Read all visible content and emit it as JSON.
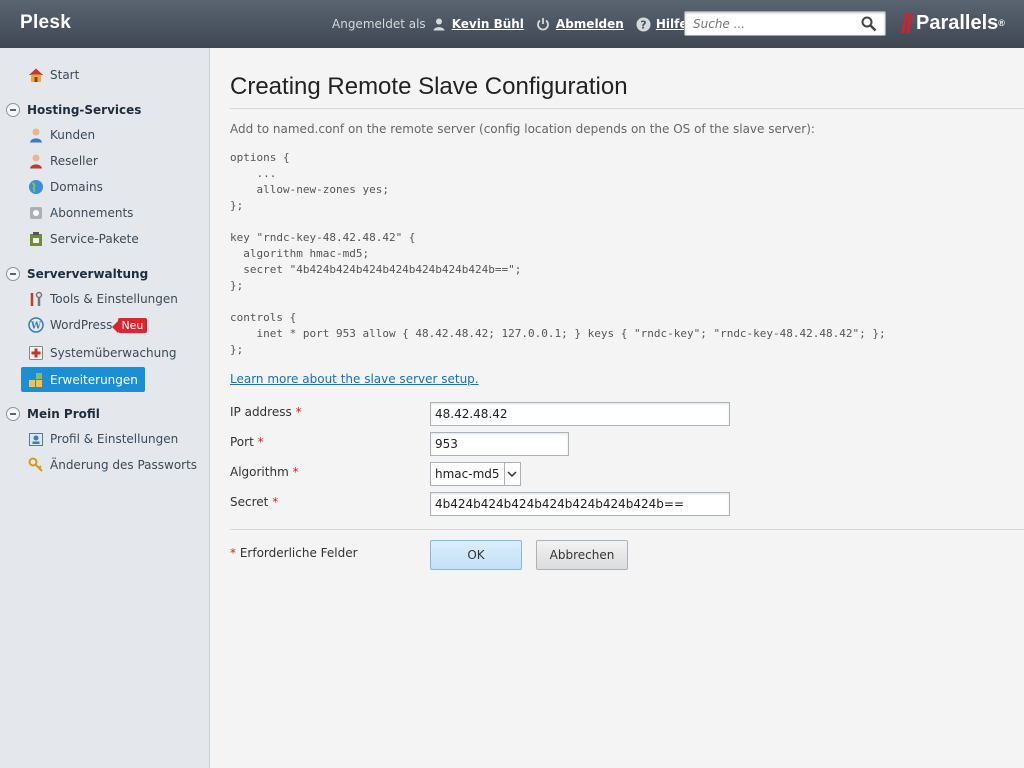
{
  "header": {
    "app_title": "Plesk",
    "signed_in_label": "Angemeldet als",
    "user_name": "Kevin Bühl",
    "logout_label": "Abmelden",
    "help_label": "Hilfe",
    "search_placeholder": "Suche ...",
    "brand": "Parallels",
    "brand_mark": "®"
  },
  "sidebar": {
    "start": "Start",
    "sections": [
      {
        "label": "Hosting-Services",
        "items": [
          "Kunden",
          "Reseller",
          "Domains",
          "Abonnements",
          "Service-Pakete"
        ]
      },
      {
        "label": "Serververwaltung",
        "items": [
          "Tools & Einstellungen",
          "WordPress",
          "Systemüberwachung",
          "Erweiterungen"
        ]
      },
      {
        "label": "Mein Profil",
        "items": [
          "Profil & Einstellungen",
          "Änderung des Passworts"
        ]
      }
    ],
    "wordpress_badge": "Neu",
    "active_item": "Erweiterungen"
  },
  "main": {
    "title": "Creating Remote Slave Configuration",
    "description": "Add to named.conf on the remote server (config location depends on the OS of the slave server):",
    "code": "options {\n    ...\n    allow-new-zones yes;\n};\n\nkey \"rndc-key-48.42.48.42\" {\n  algorithm hmac-md5;\n  secret \"4b424b424b424b424b424b424b424b==\";\n};\n\ncontrols {\n    inet * port 953 allow { 48.42.48.42; 127.0.0.1; } keys { \"rndc-key\"; \"rndc-key-48.42.48.42\"; };\n};",
    "learn_more": "Learn more about the slave server setup.",
    "form": {
      "ip_label": "IP address",
      "ip_value": "48.42.48.42",
      "port_label": "Port",
      "port_value": "953",
      "algorithm_label": "Algorithm",
      "algorithm_value": "hmac-md5",
      "secret_label": "Secret",
      "secret_value": "4b424b424b424b424b424b424b424b==",
      "required_marker": "*",
      "required_note": "Erforderliche Felder"
    },
    "buttons": {
      "ok": "OK",
      "cancel": "Abbrechen"
    }
  },
  "colors": {
    "header_bg": "#4a535e",
    "sidebar_bg": "#e4e8ec",
    "active_item": "#1c8fd4",
    "link": "#1f6fb5",
    "required": "#d22222",
    "badge": "#d7262c"
  }
}
